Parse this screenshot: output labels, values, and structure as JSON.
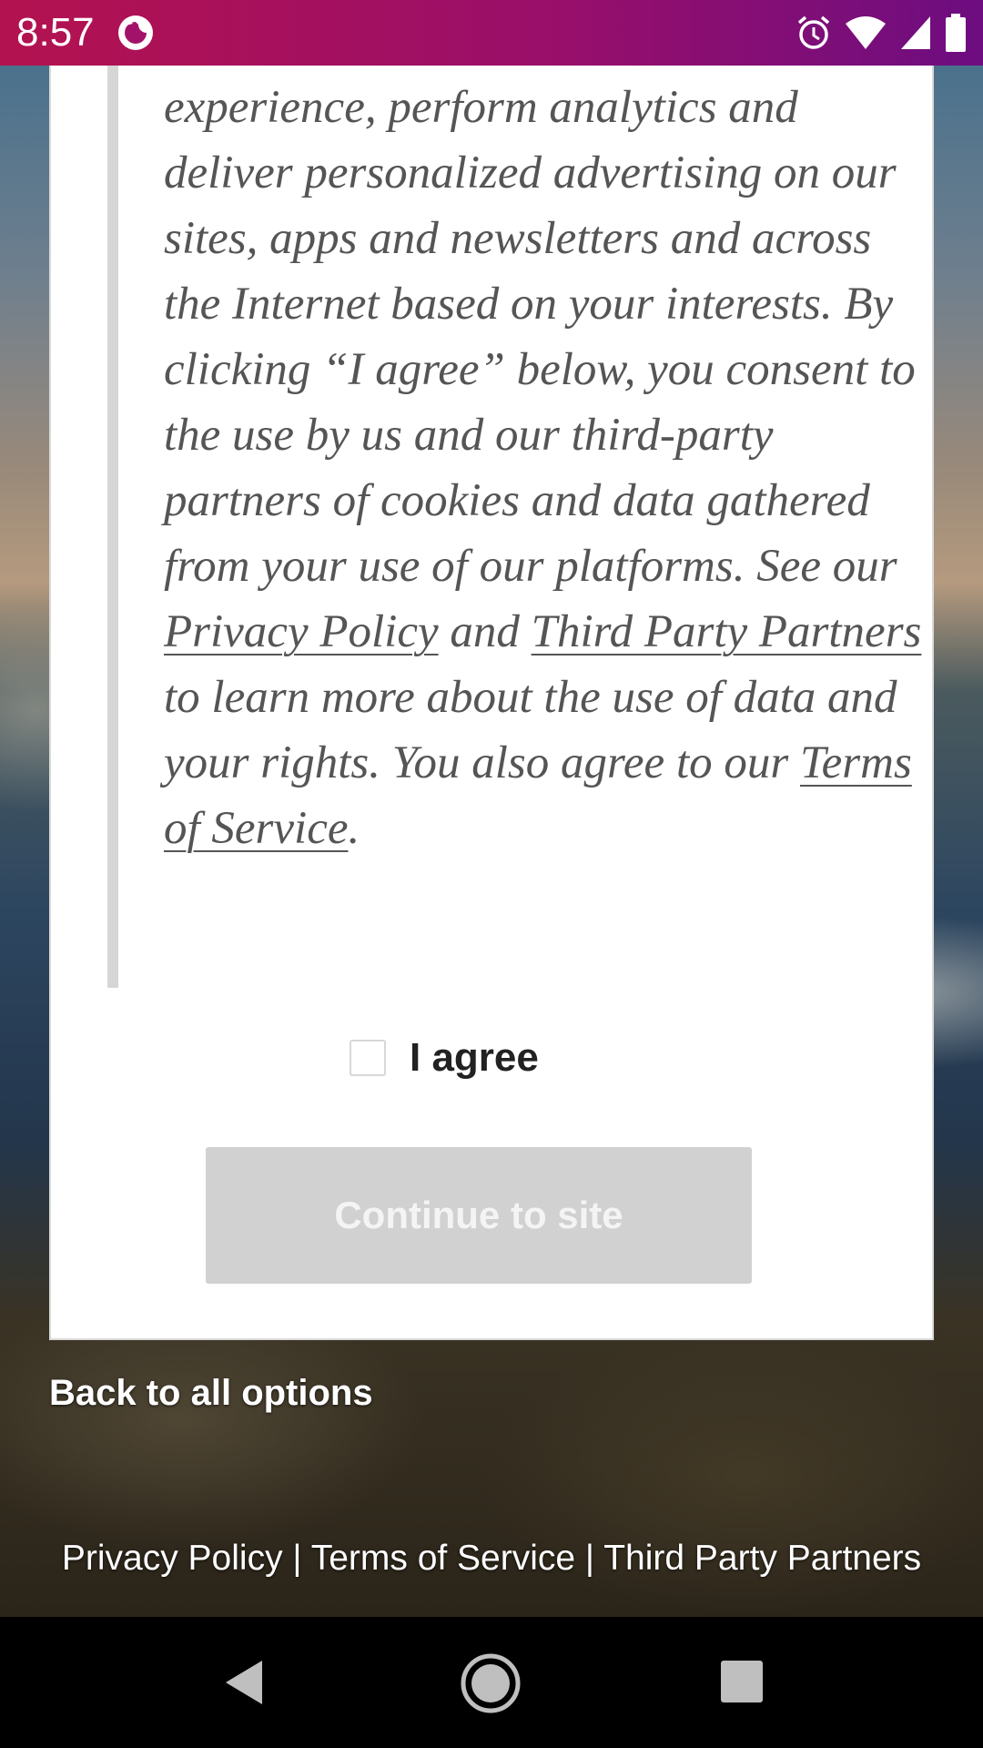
{
  "status_bar": {
    "time": "8:57",
    "left_icon": "firefox-icon",
    "right_icons": [
      "alarm-icon",
      "wifi-icon",
      "cell-signal-icon",
      "battery-icon"
    ],
    "gradient": [
      "#b3124f",
      "#6d0d80"
    ]
  },
  "consent": {
    "text_part1": "experience, perform analytics and deliver personalized advertising on our sites, apps and newsletters and across the Internet based on your interests. By clicking “I agree” below, you consent to the use by us and our third-party partners of cookies and data gathered from your use of our platforms. See our ",
    "privacy_link": "Privacy Policy",
    "text_and": " and ",
    "partners_link": "Third Party Partners ",
    "text_part2": "to learn more about the use of data and your rights. You also agree to our ",
    "terms_link": "Terms of Service",
    "text_end": ".",
    "agree_label": "I agree",
    "agree_checked": false,
    "continue_label": "Continue to site"
  },
  "back_link": "Back to all options",
  "footer": {
    "privacy": "Privacy Policy",
    "separator": " | ",
    "terms": "Terms of Service",
    "partners": "Third Party Partners"
  },
  "nav_bar": {
    "icons": [
      "back-icon",
      "home-icon",
      "recents-icon"
    ]
  }
}
